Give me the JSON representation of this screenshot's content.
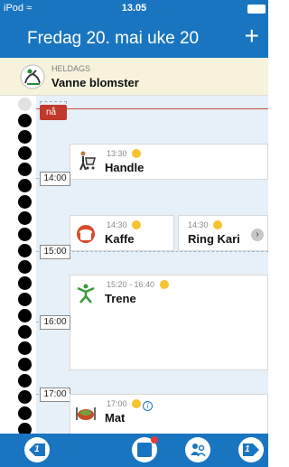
{
  "status_bar": {
    "carrier": "iPod",
    "time": "13.05"
  },
  "header": {
    "title": "Fredag 20. mai uke 20",
    "add_label": "+"
  },
  "all_day": {
    "label": "HELDAGS",
    "title": "Vanne blomster"
  },
  "timeline": {
    "now_label": "nå",
    "hour_labels": [
      "14:00",
      "15:00",
      "16:00",
      "17:00"
    ]
  },
  "events": [
    {
      "time": "13:30",
      "title": "Handle",
      "icon": "shopping-cart-icon"
    },
    {
      "time": "14:30",
      "title": "Kaffe",
      "icon": "coffee-icon"
    },
    {
      "time": "14:30",
      "title": "Ring Kari",
      "icon": "phone-icon"
    },
    {
      "time": "15:20 - 16:40",
      "title": "Trene",
      "icon": "exercise-icon"
    },
    {
      "time": "17:00",
      "title": "Mat",
      "icon": "meal-icon",
      "info": "i"
    }
  ],
  "tab_bar": {
    "items": [
      "previous-day-icon",
      "list-icon",
      "contacts-icon",
      "next-day-icon"
    ],
    "prev_number": "1",
    "next_number": "1"
  },
  "colors": {
    "primary": "#1a75c0",
    "now_red": "#c0392b",
    "allday_bg": "#f6f2dc",
    "timeline_bg": "#e6f0f8"
  }
}
